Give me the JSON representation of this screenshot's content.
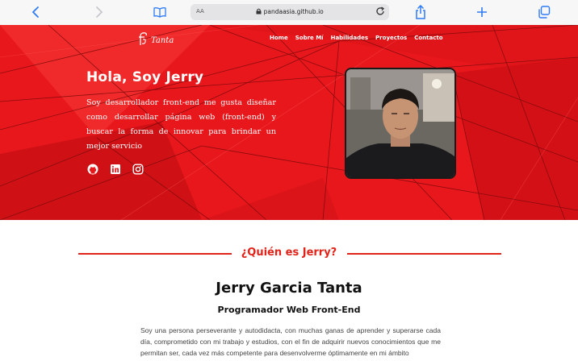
{
  "browser": {
    "text_size_label": "AA",
    "url": "pandaasia.github.io",
    "icons": [
      "chevron-left-icon",
      "chevron-right-icon",
      "book-icon",
      "lock-icon",
      "reload-icon",
      "share-icon",
      "plus-icon",
      "tabs-icon"
    ]
  },
  "site": {
    "logo_text": "Tanta",
    "nav": [
      "Home",
      "Sobre Mí",
      "Habilidades",
      "Proyectos",
      "Contacto"
    ],
    "hero_title": "Hola, Soy Jerry",
    "hero_text": "Soy desarrollador front-end me gusta diseñar como desarrollar página web (front-end) y buscar la forma de innovar para brindar un mejor servicio",
    "social_icons": [
      "github-icon",
      "linkedin-icon",
      "instagram-icon"
    ],
    "accent_color": "#e2231a"
  },
  "about": {
    "title": "¿Quién es Jerry?",
    "name": "Jerry Garcia Tanta",
    "role": "Programador Web Front-End",
    "bio": "Soy una persona perseverante y autodidacta, con muchas ganas de aprender y superarse cada día, comprometido con mi trabajo y estudios, con el fin de adquirir nuevos conocimientos que me permitan ser, cada vez más competente para desenvolverme óptimamente en mi ámbito"
  }
}
